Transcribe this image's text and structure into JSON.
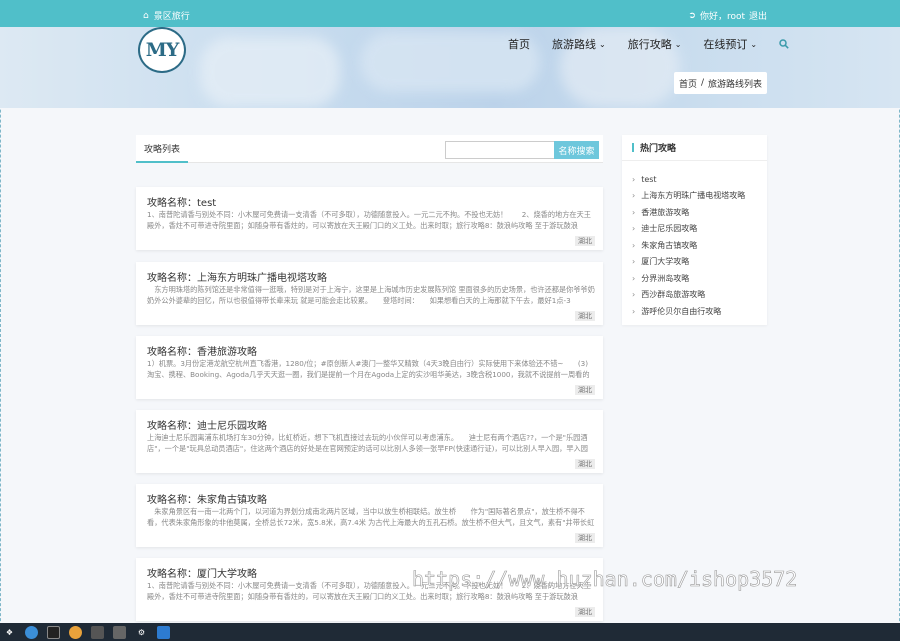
{
  "topbar": {
    "site_name": "景区旅行",
    "greeting": "你好，root",
    "logout": "退出"
  },
  "logo": {
    "text": "MY"
  },
  "nav": {
    "items": [
      {
        "label": "首页",
        "dropdown": false
      },
      {
        "label": "旅游路线",
        "dropdown": true
      },
      {
        "label": "旅行攻略",
        "dropdown": true
      },
      {
        "label": "在线预订",
        "dropdown": true
      }
    ]
  },
  "breadcrumb": {
    "home": "首页",
    "sep": "/",
    "current": "旅游路线列表"
  },
  "list": {
    "tab_label": "攻略列表",
    "search_placeholder": "",
    "search_button": "名称搜索"
  },
  "cards": [
    {
      "title": "攻略名称：test",
      "desc": "1、南普陀请香与别处不同：小木屋可免费请一支清香（不可多取），功德随意投入。一元二元不拘。不投也无妨！　　2、烧香的地方在天王殿外，香炷不可带进寺院里面；如随身带有香炷的，可以寄放在天王殿门口的义工处。出来时取；旅行攻略8：鼓浪屿攻略 至于游玩鼓浪",
      "tag": "湖北"
    },
    {
      "title": "攻略名称：上海东方明珠广播电视塔攻略",
      "desc": "　东方明珠塔的陈列馆还是非常值得一逛哦，特别是对于上海宁，这里是上海城市历史发展陈列馆 里面很多的历史场景，也许还都是你爷爷奶奶外公外婆辈的回忆，所以也很值得带长辈来玩 就是可能会走比较累。　　登塔时间：　　如果想看白天的上海那就下午去，最好1点-3",
      "tag": "湖北"
    },
    {
      "title": "攻略名称：香港旅游攻略",
      "desc": "1）机票。3月份定港龙航空杭州直飞香港，1280/位；#原创新人#澳门一整华又精致（4天3晚自由行）实际使用下来体验还不错~　　(3)淘宝、携程、Booking、Agoda几乎天天逛一圈，我们是提前一个月在Agoda上定的实沙咀华美达，3晚含税1000，我就不说提前一周看的时",
      "tag": "湖北"
    },
    {
      "title": "攻略名称：迪士尼乐园攻略",
      "desc": "上海迪士尼乐园离浦东机场打车30分钟，比虹桥近，想下飞机直接过去玩的小伙伴可以考虑浦东。　　迪士尼有两个酒店??，一个是\"乐园酒店\"，一个是\"玩具总动员酒店\"，住这两个酒店的好处是在官网预定的话可以比别人多领一张早FP(快速通行证)，可以比别人早入园，早入园的",
      "tag": "湖北"
    },
    {
      "title": "攻略名称：朱家角古镇攻略",
      "desc": "　朱家角景区有一南一北两个门，以河道为界划分成南北两片区域，当中以放生桥相联结。放生桥　　作为\"国际著名景点\"，放生桥不得不看，代表朱家角形象的非他莫属，全桥总长72米，宽5.8米，高7.4米 为古代上海最大的五孔石桥。放生桥不但大气，且文气，素有\"井带长虹",
      "tag": "湖北"
    },
    {
      "title": "攻略名称：厦门大学攻略",
      "desc": "1、南普陀请香与别处不同：小木屋可免费请一支清香（不可多取），功德随意投入。一元二元不拘。不投也无妨！　　2、烧香的地方在天王殿外，香炷不可带进寺院里面；如随身带有香炷的，可以寄放在天王殿门口的义工处。出来时取；旅行攻略8：鼓浪屿攻略 至于游玩鼓浪",
      "tag": "湖北"
    }
  ],
  "sidebar": {
    "title": "热门攻略",
    "items": [
      "test",
      "上海东方明珠广播电视塔攻略",
      "香港旅游攻略",
      "迪士尼乐园攻略",
      "朱家角古镇攻略",
      "厦门大学攻略",
      "分界洲岛攻略",
      "西沙群岛旅游攻略",
      "游呼伦贝尔自由行攻略"
    ]
  },
  "watermark": "https://www.huzhan.com/ishop3572",
  "colors": {
    "accent": "#50bfc9",
    "search_button": "#6ec7dc"
  }
}
